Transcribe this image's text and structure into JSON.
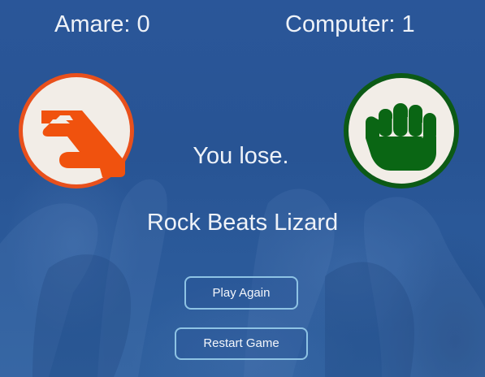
{
  "scoreboard": {
    "player": "Amare: 0",
    "computer": "Computer: 1"
  },
  "player_choice": {
    "icon": "lizard-hand-icon",
    "color": "#e8501c"
  },
  "computer_choice": {
    "icon": "rock-fist-icon",
    "color": "#0c5a16"
  },
  "result_text": "You lose.",
  "rule_text": "Rock Beats Lizard",
  "buttons": {
    "play_again": "Play Again",
    "restart_game": "Restart Game"
  },
  "colors": {
    "background": "#275394",
    "button_border": "#8ec3e4",
    "text": "#eef2f8"
  }
}
